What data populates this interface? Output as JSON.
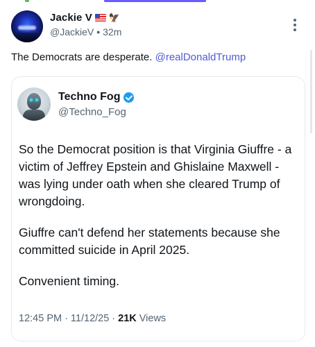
{
  "post": {
    "author": {
      "display_name": "Jackie V",
      "handle": "@JackieV",
      "time": "32m",
      "separator": "•",
      "name_emoji": [
        "flag-us-icon",
        "eagle-icon"
      ]
    },
    "text": "The Democrats are desperate. ",
    "mention": "@realDonaldTrump"
  },
  "quoted_post": {
    "author": {
      "display_name": "Techno Fog",
      "handle": "@Techno_Fog",
      "verified": true
    },
    "paragraphs": [
      "So the Democrat position is that Virginia Giuffre - a victim of Jeffrey Epstein and Ghislaine Maxwell - was lying under oath when she cleared Trump of wrongdoing.",
      "Giuffre can't defend her statements because she committed suicide in April 2025.",
      "Convenient timing."
    ],
    "footer": {
      "time": "12:45 PM",
      "dot1": "·",
      "date": "11/12/25",
      "dot2": "·",
      "views_count": "21K",
      "views_label": "Views"
    }
  },
  "colors": {
    "mention": "#4f5bd5",
    "verified": "#1d9bf0",
    "secondary_text": "#536471",
    "accent_bar": "#6a5cff"
  }
}
